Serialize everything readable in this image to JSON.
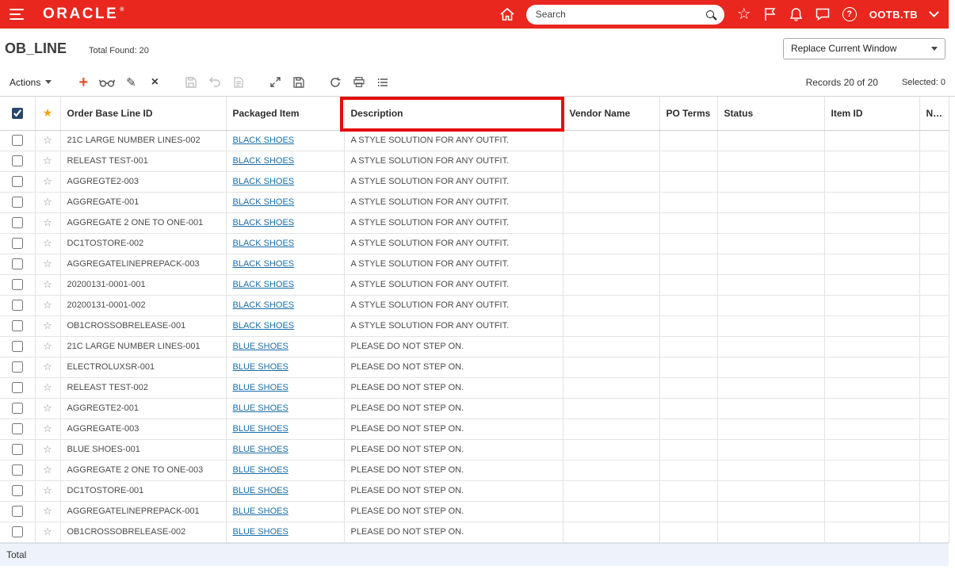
{
  "topbar": {
    "brand": "ORACLE",
    "brand_mark": "®",
    "search_placeholder": "Search",
    "username": "OOTB.TB"
  },
  "page": {
    "title": "OB_LINE",
    "total_found": "Total Found: 20",
    "window_mode": "Replace Current Window"
  },
  "toolbar": {
    "actions_label": "Actions",
    "records_summary": "Records 20 of 20",
    "selected_summary": "Selected: 0",
    "icons": [
      "add-icon",
      "view-icon",
      "edit-icon",
      "delete-icon",
      "save-icon",
      "undo-icon",
      "mass-edit-icon",
      "expand-icon",
      "save-view-icon",
      "refresh-icon",
      "print-icon",
      "detail-list-icon"
    ]
  },
  "table": {
    "columns": [
      "Order Base Line ID",
      "Packaged Item",
      "Description",
      "Vendor Name",
      "PO Terms",
      "Status",
      "Item ID",
      "NLT"
    ],
    "rows": [
      {
        "order_base_line_id": "21C LARGE NUMBER LINES-002",
        "packaged_item": "BLACK SHOES",
        "description": "A STYLE SOLUTION FOR ANY OUTFIT."
      },
      {
        "order_base_line_id": "RELEAST TEST-001",
        "packaged_item": "BLACK SHOES",
        "description": "A STYLE SOLUTION FOR ANY OUTFIT."
      },
      {
        "order_base_line_id": "AGGREGTE2-003",
        "packaged_item": "BLACK SHOES",
        "description": "A STYLE SOLUTION FOR ANY OUTFIT."
      },
      {
        "order_base_line_id": "AGGREGATE-001",
        "packaged_item": "BLACK SHOES",
        "description": "A STYLE SOLUTION FOR ANY OUTFIT."
      },
      {
        "order_base_line_id": "AGGREGATE 2 ONE TO ONE-001",
        "packaged_item": "BLACK SHOES",
        "description": "A STYLE SOLUTION FOR ANY OUTFIT."
      },
      {
        "order_base_line_id": "DC1TOSTORE-002",
        "packaged_item": "BLACK SHOES",
        "description": "A STYLE SOLUTION FOR ANY OUTFIT."
      },
      {
        "order_base_line_id": "AGGREGATELINEPREPACK-003",
        "packaged_item": "BLACK SHOES",
        "description": "A STYLE SOLUTION FOR ANY OUTFIT."
      },
      {
        "order_base_line_id": "20200131-0001-001",
        "packaged_item": "BLACK SHOES",
        "description": "A STYLE SOLUTION FOR ANY OUTFIT."
      },
      {
        "order_base_line_id": "20200131-0001-002",
        "packaged_item": "BLACK SHOES",
        "description": "A STYLE SOLUTION FOR ANY OUTFIT."
      },
      {
        "order_base_line_id": "OB1CROSSOBRELEASE-001",
        "packaged_item": "BLACK SHOES",
        "description": "A STYLE SOLUTION FOR ANY OUTFIT."
      },
      {
        "order_base_line_id": "21C LARGE NUMBER LINES-001",
        "packaged_item": "BLUE SHOES",
        "description": "PLEASE DO NOT STEP ON."
      },
      {
        "order_base_line_id": "ELECTROLUXSR-001",
        "packaged_item": "BLUE SHOES",
        "description": "PLEASE DO NOT STEP ON."
      },
      {
        "order_base_line_id": "RELEAST TEST-002",
        "packaged_item": "BLUE SHOES",
        "description": "PLEASE DO NOT STEP ON."
      },
      {
        "order_base_line_id": "AGGREGTE2-001",
        "packaged_item": "BLUE SHOES",
        "description": "PLEASE DO NOT STEP ON."
      },
      {
        "order_base_line_id": "AGGREGATE-003",
        "packaged_item": "BLUE SHOES",
        "description": "PLEASE DO NOT STEP ON."
      },
      {
        "order_base_line_id": "BLUE SHOES-001",
        "packaged_item": "BLUE SHOES",
        "description": "PLEASE DO NOT STEP ON."
      },
      {
        "order_base_line_id": "AGGREGATE 2 ONE TO ONE-003",
        "packaged_item": "BLUE SHOES",
        "description": "PLEASE DO NOT STEP ON."
      },
      {
        "order_base_line_id": "DC1TOSTORE-001",
        "packaged_item": "BLUE SHOES",
        "description": "PLEASE DO NOT STEP ON."
      },
      {
        "order_base_line_id": "AGGREGATELINEPREPACK-001",
        "packaged_item": "BLUE SHOES",
        "description": "PLEASE DO NOT STEP ON."
      },
      {
        "order_base_line_id": "OB1CROSSOBRELEASE-002",
        "packaged_item": "BLUE SHOES",
        "description": "PLEASE DO NOT STEP ON."
      }
    ],
    "total_label": "Total"
  },
  "annotation": {
    "highlight_color": "#e30e0e",
    "target": "Description column header"
  }
}
